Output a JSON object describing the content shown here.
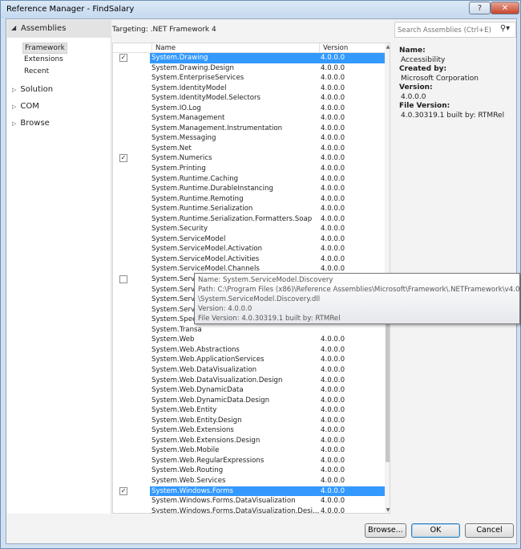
{
  "window": {
    "title": "Reference Manager - FindSalary",
    "help_label": "?",
    "close_label": "✕"
  },
  "nav": {
    "header": "Assemblies",
    "subitems": [
      "Framework",
      "Extensions",
      "Recent"
    ],
    "groups": [
      "Solution",
      "COM",
      "Browse"
    ]
  },
  "targeting": "Targeting: .NET Framework 4",
  "search": {
    "placeholder": "Search Assemblies (Ctrl+E)"
  },
  "grid": {
    "columns": [
      "Name",
      "Version"
    ],
    "rows": [
      {
        "name": "System.Drawing",
        "version": "4.0.0.0",
        "checkbox": "checked",
        "selected": true
      },
      {
        "name": "System.Drawing.Design",
        "version": "4.0.0.0"
      },
      {
        "name": "System.EnterpriseServices",
        "version": "4.0.0.0"
      },
      {
        "name": "System.IdentityModel",
        "version": "4.0.0.0"
      },
      {
        "name": "System.IdentityModel.Selectors",
        "version": "4.0.0.0"
      },
      {
        "name": "System.IO.Log",
        "version": "4.0.0.0"
      },
      {
        "name": "System.Management",
        "version": "4.0.0.0"
      },
      {
        "name": "System.Management.Instrumentation",
        "version": "4.0.0.0"
      },
      {
        "name": "System.Messaging",
        "version": "4.0.0.0"
      },
      {
        "name": "System.Net",
        "version": "4.0.0.0"
      },
      {
        "name": "System.Numerics",
        "version": "4.0.0.0",
        "checkbox": "checked"
      },
      {
        "name": "System.Printing",
        "version": "4.0.0.0"
      },
      {
        "name": "System.Runtime.Caching",
        "version": "4.0.0.0"
      },
      {
        "name": "System.Runtime.DurableInstancing",
        "version": "4.0.0.0"
      },
      {
        "name": "System.Runtime.Remoting",
        "version": "4.0.0.0"
      },
      {
        "name": "System.Runtime.Serialization",
        "version": "4.0.0.0"
      },
      {
        "name": "System.Runtime.Serialization.Formatters.Soap",
        "version": "4.0.0.0"
      },
      {
        "name": "System.Security",
        "version": "4.0.0.0"
      },
      {
        "name": "System.ServiceModel",
        "version": "4.0.0.0"
      },
      {
        "name": "System.ServiceModel.Activation",
        "version": "4.0.0.0"
      },
      {
        "name": "System.ServiceModel.Activities",
        "version": "4.0.0.0"
      },
      {
        "name": "System.ServiceModel.Channels",
        "version": "4.0.0.0"
      },
      {
        "name": "System.ServiceModel.Discovery",
        "version": "4.0.0.0",
        "checkbox": "unchecked"
      },
      {
        "name": "System.ServiceModel.Routing",
        "version": "4.0.0.0"
      },
      {
        "name": "System.Service",
        "version": ""
      },
      {
        "name": "System.Service",
        "version": ""
      },
      {
        "name": "System.Speech",
        "version": ""
      },
      {
        "name": "System.Transa",
        "version": ""
      },
      {
        "name": "System.Web",
        "version": "4.0.0.0"
      },
      {
        "name": "System.Web.Abstractions",
        "version": "4.0.0.0"
      },
      {
        "name": "System.Web.ApplicationServices",
        "version": "4.0.0.0"
      },
      {
        "name": "System.Web.DataVisualization",
        "version": "4.0.0.0"
      },
      {
        "name": "System.Web.DataVisualization.Design",
        "version": "4.0.0.0"
      },
      {
        "name": "System.Web.DynamicData",
        "version": "4.0.0.0"
      },
      {
        "name": "System.Web.DynamicData.Design",
        "version": "4.0.0.0"
      },
      {
        "name": "System.Web.Entity",
        "version": "4.0.0.0"
      },
      {
        "name": "System.Web.Entity.Design",
        "version": "4.0.0.0"
      },
      {
        "name": "System.Web.Extensions",
        "version": "4.0.0.0"
      },
      {
        "name": "System.Web.Extensions.Design",
        "version": "4.0.0.0"
      },
      {
        "name": "System.Web.Mobile",
        "version": "4.0.0.0"
      },
      {
        "name": "System.Web.RegularExpressions",
        "version": "4.0.0.0"
      },
      {
        "name": "System.Web.Routing",
        "version": "4.0.0.0"
      },
      {
        "name": "System.Web.Services",
        "version": "4.0.0.0"
      },
      {
        "name": "System.Windows.Forms",
        "version": "4.0.0.0",
        "checkbox": "checked",
        "selected": true
      },
      {
        "name": "System.Windows.Forms.DataVisualization",
        "version": "4.0.0.0"
      },
      {
        "name": "System.Windows.Forms.DataVisualization.Desi...",
        "version": "4.0.0.0"
      }
    ]
  },
  "details": {
    "name_label": "Name:",
    "name_value": "Accessibility",
    "created_label": "Created by:",
    "created_value": "Microsoft Corporation",
    "version_label": "Version:",
    "version_value": "4.0.0.0",
    "file_version_label": "File Version:",
    "file_version_value": "4.0.30319.1 built by: RTMRel"
  },
  "tooltip": {
    "lines": [
      "Name: System.ServiceModel.Discovery",
      "Path: C:\\Program Files (x86)\\Reference Assemblies\\Microsoft\\Framework\\.NETFramework\\v4.0",
      "\\System.ServiceModel.Discovery.dll",
      "Version: 4.0.0.0",
      "File Version: 4.0.30319.1 built by: RTMRel"
    ]
  },
  "buttons": {
    "browse": "Browse...",
    "ok": "OK",
    "cancel": "Cancel"
  },
  "colors": {
    "selection": "#3399ff",
    "window_frame": "#cfe0f2",
    "close_button": "#c7432b"
  }
}
